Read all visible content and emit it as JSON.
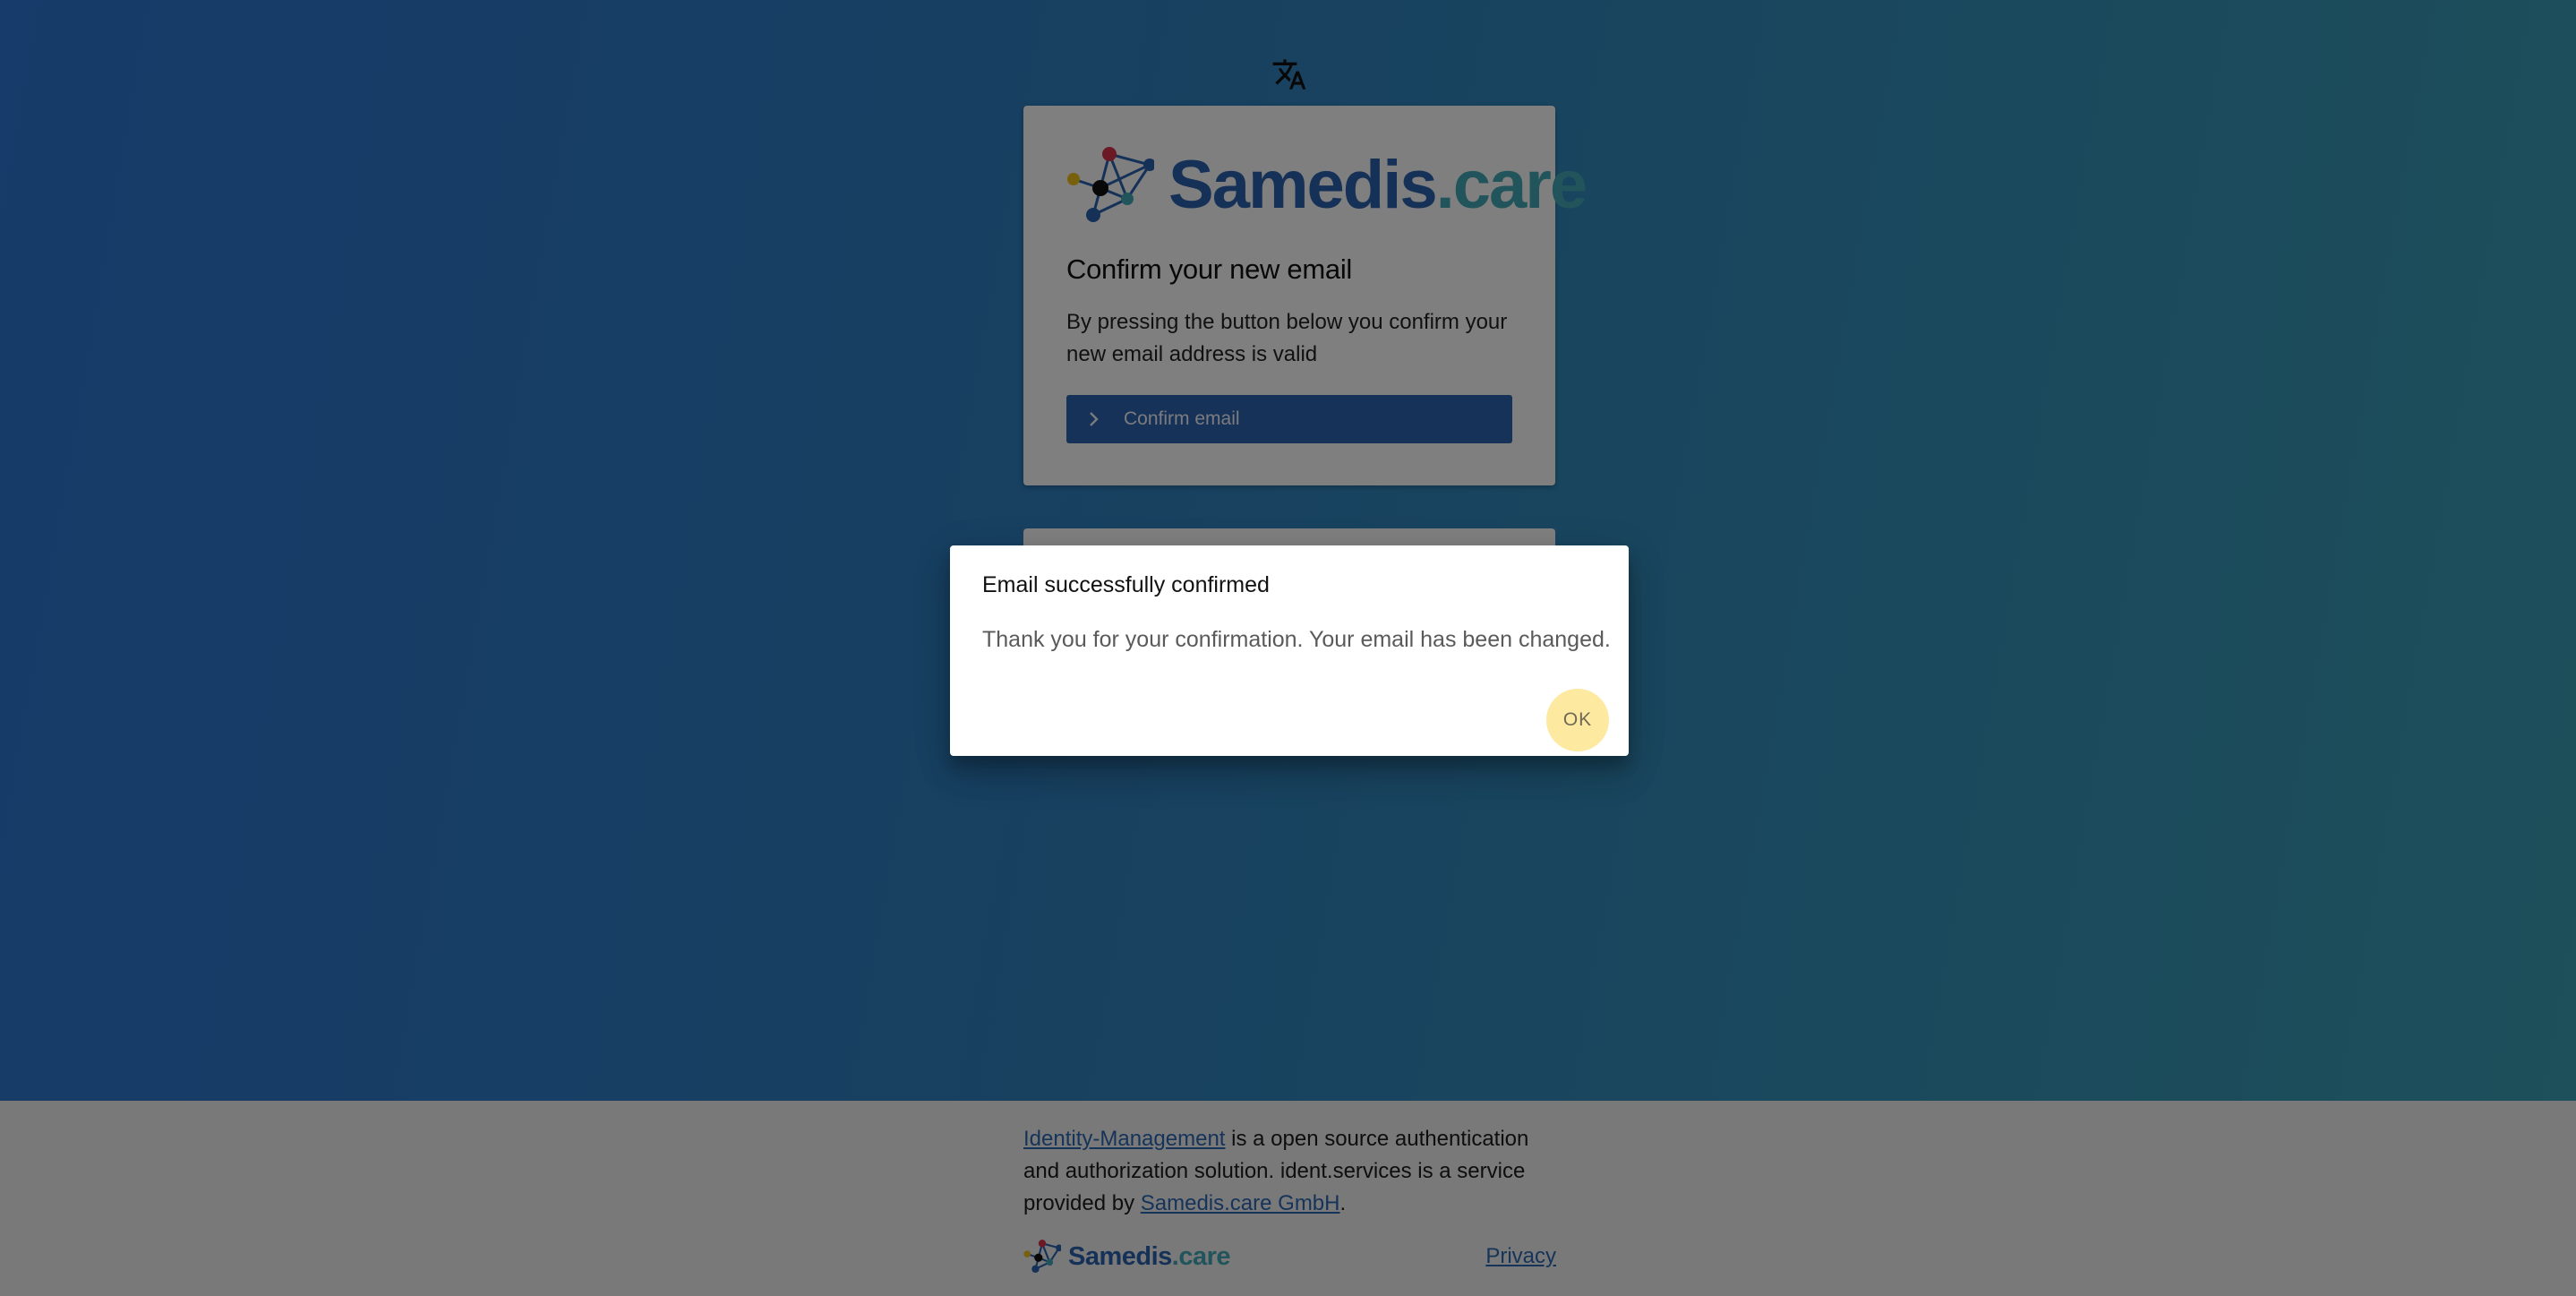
{
  "brand": {
    "name_main": "Samedis",
    "name_suffix": ".care",
    "color_blue": "#2b63b0",
    "color_teal": "#44a8b8"
  },
  "language_icon": "translate-icon",
  "card": {
    "title": "Confirm your new email",
    "description": "By pressing the button below you confirm your new email address is valid",
    "confirm_button": {
      "label": "Confirm email",
      "icon": "chevron-right-icon"
    },
    "button_color": "#2d64b3"
  },
  "dialog": {
    "title": "Email successfully confirmed",
    "message": "Thank you for your confirmation. Your email has been changed.",
    "ok_label": "OK"
  },
  "footer": {
    "link1": "Identity-Management",
    "text1": " is a open source authentication and authorization solution. ident.services is a service provided by ",
    "link2": "Samedis.care GmbH",
    "text2": ".",
    "privacy_label": "Privacy"
  }
}
